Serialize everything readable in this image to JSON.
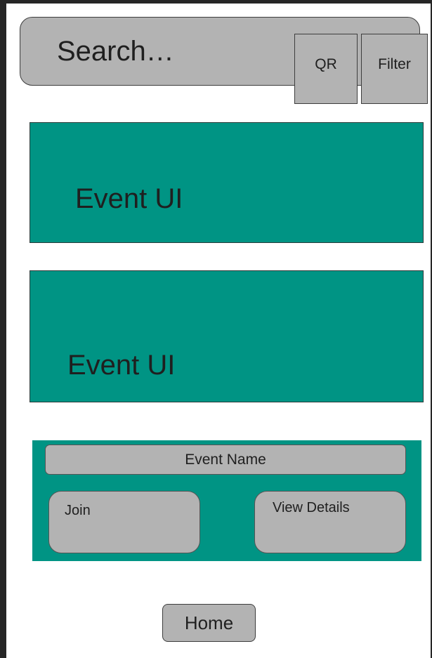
{
  "search": {
    "placeholder": "Search…",
    "qr_label": "QR",
    "filter_label": "Filter"
  },
  "events": [
    {
      "label": "Event UI"
    },
    {
      "label": "Event UI"
    }
  ],
  "event_detail": {
    "name": "Event Name",
    "join_label": "Join",
    "view_details_label": "View Details"
  },
  "nav": {
    "home_label": "Home"
  },
  "colors": {
    "accent": "#009484",
    "control": "#b3b3b3",
    "frame": "#262626"
  }
}
